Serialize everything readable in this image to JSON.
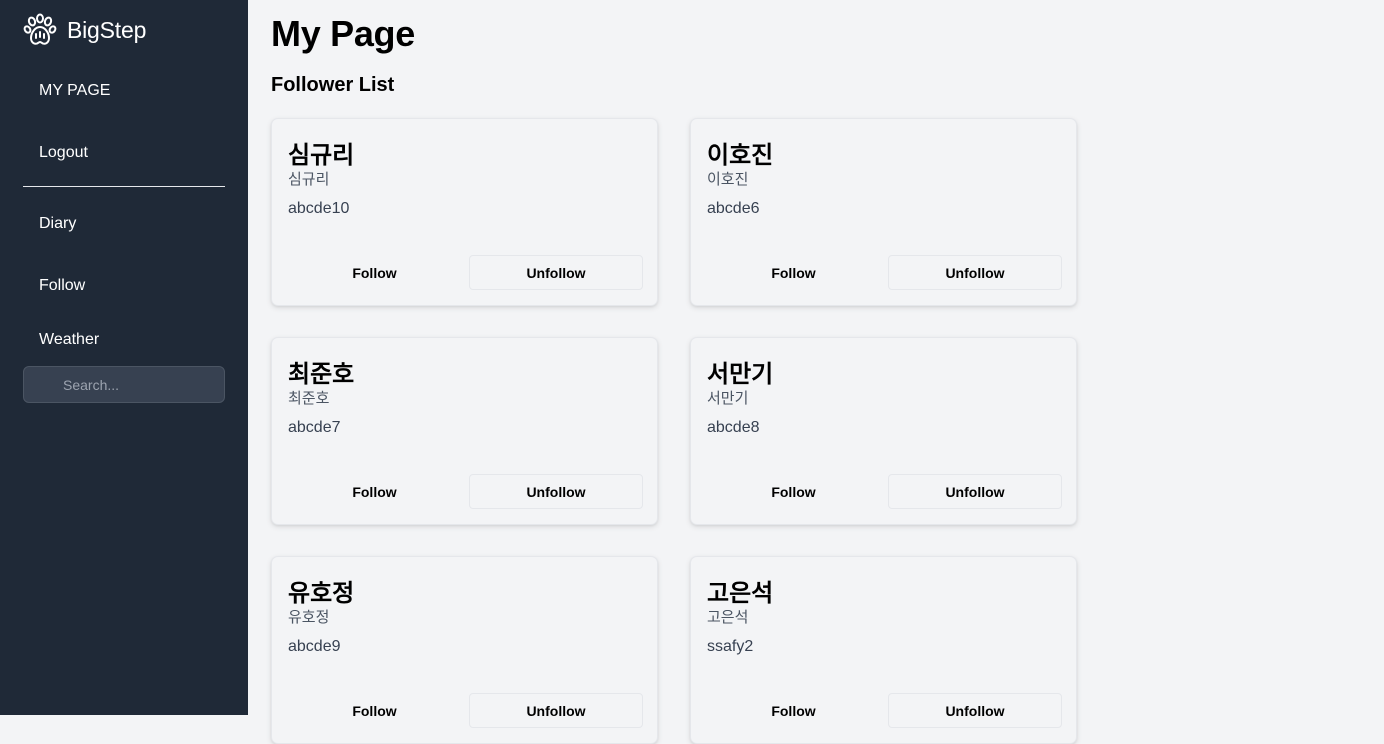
{
  "sidebar": {
    "brand": "BigStep",
    "brand_icon": "paw-icon",
    "items": [
      {
        "label": "MY PAGE"
      },
      {
        "label": "Logout"
      },
      {
        "label": "Diary"
      },
      {
        "label": "Follow"
      },
      {
        "label": "Weather"
      }
    ],
    "search_placeholder": "Search..."
  },
  "main": {
    "title": "My Page",
    "section_title": "Follower List",
    "cards": [
      {
        "name": "심규리",
        "sub": "심규리",
        "id": "abcde10",
        "follow": "Follow",
        "unfollow": "Unfollow"
      },
      {
        "name": "이호진",
        "sub": "이호진",
        "id": "abcde6",
        "follow": "Follow",
        "unfollow": "Unfollow"
      },
      {
        "name": "최준호",
        "sub": "최준호",
        "id": "abcde7",
        "follow": "Follow",
        "unfollow": "Unfollow"
      },
      {
        "name": "서만기",
        "sub": "서만기",
        "id": "abcde8",
        "follow": "Follow",
        "unfollow": "Unfollow"
      },
      {
        "name": "유호정",
        "sub": "유호정",
        "id": "abcde9",
        "follow": "Follow",
        "unfollow": "Unfollow"
      },
      {
        "name": "고은석",
        "sub": "고은석",
        "id": "ssafy2",
        "follow": "Follow",
        "unfollow": "Unfollow"
      }
    ]
  },
  "colors": {
    "sidebar_bg": "#1f2937",
    "page_bg": "#f3f4f6",
    "search_bg": "#374151"
  }
}
